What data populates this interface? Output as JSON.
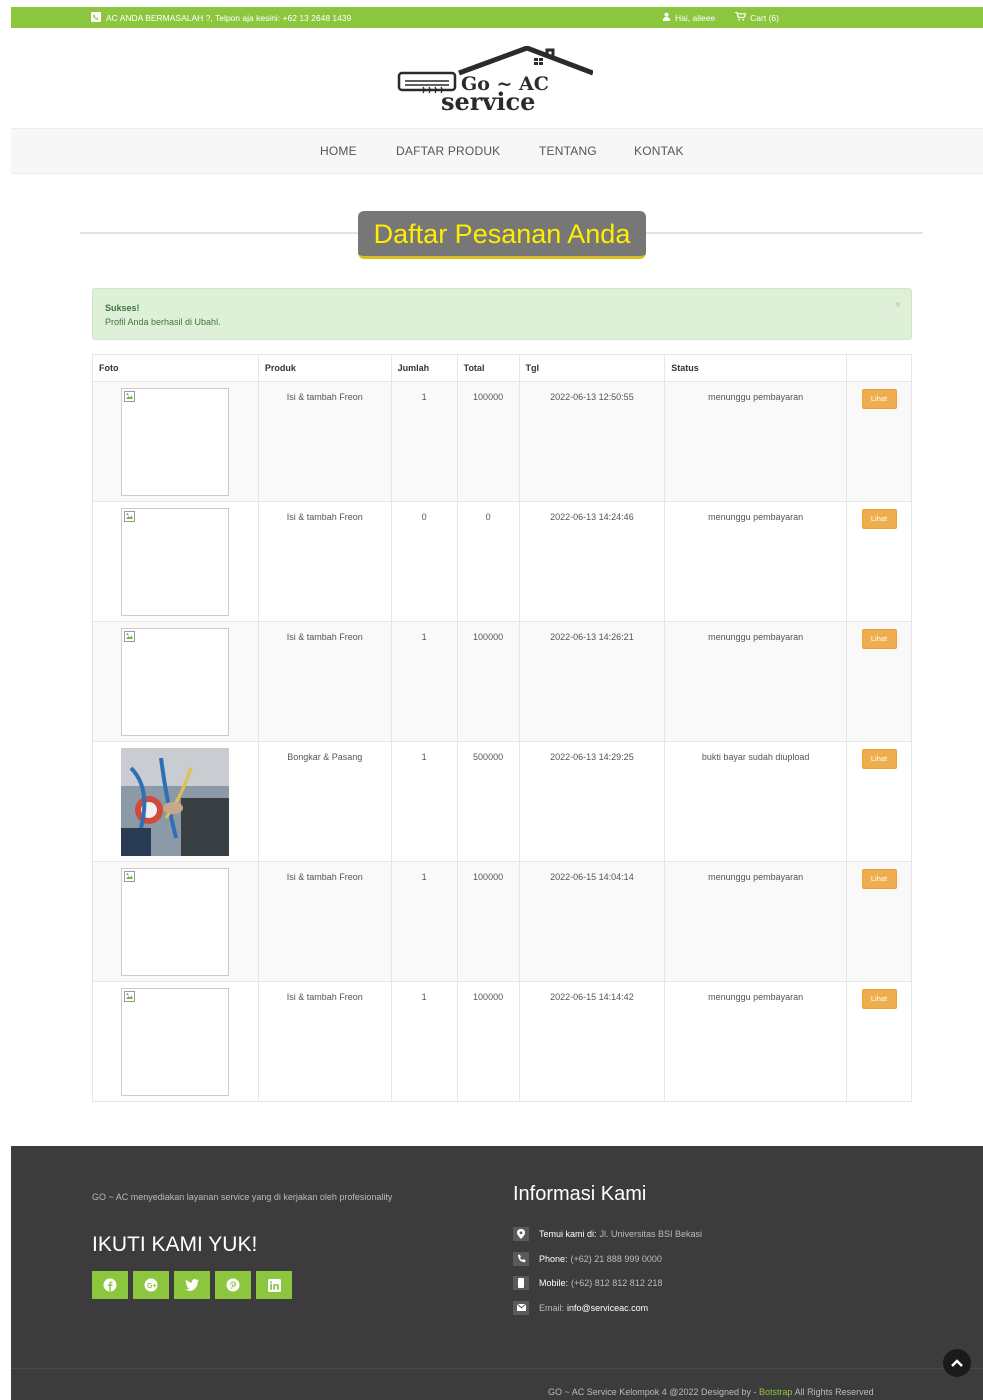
{
  "topbar": {
    "message": "AC ANDA BERMASALAH ?, Telpon aja kesini: +62 13 2648 1439",
    "user_greeting": "Hai, aileee",
    "cart_label": "Cart (6)"
  },
  "logo": {
    "line1": "Go ~ AC",
    "line2": "service"
  },
  "nav": {
    "items": [
      "HOME",
      "DAFTAR PRODUK",
      "TENTANG",
      "KONTAK"
    ]
  },
  "page": {
    "title": "Daftar Pesanan Anda"
  },
  "alert": {
    "title": "Sukses!",
    "message": "Profil Anda berhasil di Ubahl.",
    "close": "×"
  },
  "table": {
    "headers": [
      "Foto",
      "Produk",
      "Jumlah",
      "Total",
      "Tgl",
      "Status",
      ""
    ],
    "button_label": "Lihat",
    "rows": [
      {
        "produk": "Isi & tambah Freon",
        "jumlah": "1",
        "total": "100000",
        "tgl": "2022-06-13 12:50:55",
        "status": "menunggu pembayaran",
        "image": "broken-image"
      },
      {
        "produk": "Isi & tambah Freon",
        "jumlah": "0",
        "total": "0",
        "tgl": "2022-06-13 14:24:46",
        "status": "menunggu pembayaran",
        "image": "broken-image"
      },
      {
        "produk": "Isi & tambah Freon",
        "jumlah": "1",
        "total": "100000",
        "tgl": "2022-06-13 14:26:21",
        "status": "menunggu pembayaran",
        "image": "broken-image"
      },
      {
        "produk": "Bongkar & Pasang",
        "jumlah": "1",
        "total": "500000",
        "tgl": "2022-06-13 14:29:25",
        "status": "bukti bayar sudah diupload",
        "image": "ac-service-photo"
      },
      {
        "produk": "Isi & tambah Freon",
        "jumlah": "1",
        "total": "100000",
        "tgl": "2022-06-15 14:04:14",
        "status": "menunggu pembayaran",
        "image": "broken-image"
      },
      {
        "produk": "Isi & tambah Freon",
        "jumlah": "1",
        "total": "100000",
        "tgl": "2022-06-15 14:14:42",
        "status": "menunggu pembayaran",
        "image": "broken-image"
      }
    ]
  },
  "footer": {
    "description": "GO ~ AC menyediakan layanan service yang di kerjakan oleh profesionality",
    "follow_title": "IKUTI KAMI YUK!",
    "socials": [
      "facebook-icon",
      "google-plus-icon",
      "twitter-icon",
      "pinterest-icon",
      "linkedin-icon"
    ],
    "info_title": "Informasi Kami",
    "address_label": "Temui kami di:",
    "address_value": "Jl. Universitas BSI Bekasi",
    "phone_label": "Phone:",
    "phone_value": "(+62) 21 888 999 0000",
    "mobile_label": "Mobile:",
    "mobile_value": "(+62) 812 812 812 218",
    "email_label": "Email:",
    "email_value": "info@serviceac.com",
    "copyright_prefix": "GO ~ AC Service Kelompok 4 @2022 Designed by -",
    "copyright_link": "Botstrap",
    "copyright_suffix": "All Rights Reserved"
  },
  "colors": {
    "brand_green": "#8cc63f",
    "title_yellow": "#ffee00",
    "button_orange": "#f0ad4e",
    "footer_bg": "#3c3c3c"
  }
}
